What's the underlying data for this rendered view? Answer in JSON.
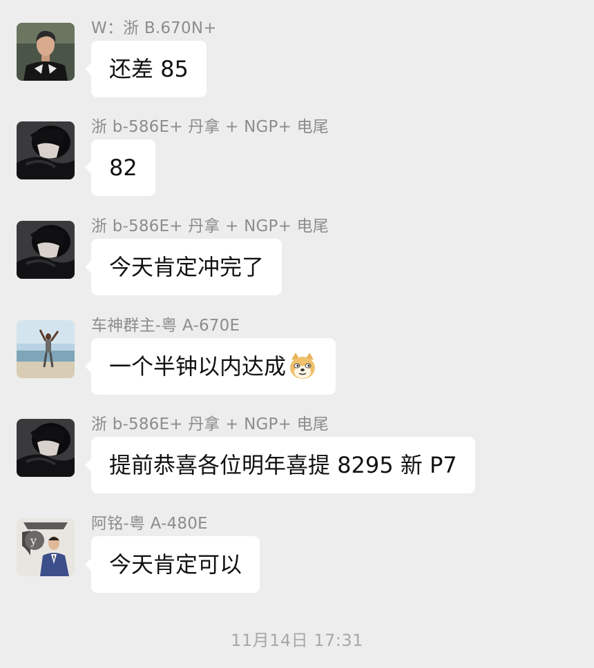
{
  "messages": [
    {
      "sender": "W：浙 B.670N+",
      "text": "还差 85",
      "avatar": "avatar-man-jacket"
    },
    {
      "sender": "浙 b-586E+ 丹拿 + NGP+ 电尾",
      "text": "82",
      "avatar": "avatar-anime-boy"
    },
    {
      "sender": "浙 b-586E+ 丹拿 + NGP+ 电尾",
      "text": "今天肯定冲完了",
      "avatar": "avatar-anime-boy"
    },
    {
      "sender": "车神群主-粤 A-670E",
      "text": "一个半钟以内达成",
      "emoji": "doge-emoji",
      "avatar": "avatar-beach-person"
    },
    {
      "sender": "浙 b-586E+ 丹拿 + NGP+ 电尾",
      "text": "提前恭喜各位明年喜提 8295 新 P7",
      "avatar": "avatar-anime-boy"
    },
    {
      "sender": "阿铭-粤 A-480E",
      "text": "今天肯定可以",
      "avatar": "avatar-suit-man"
    }
  ],
  "timestamp": "11月14日 17:31",
  "colors": {
    "background": "#ededed",
    "bubble": "#ffffff",
    "sender_text": "#8c8c8c",
    "timestamp_text": "#a8a8a8"
  }
}
